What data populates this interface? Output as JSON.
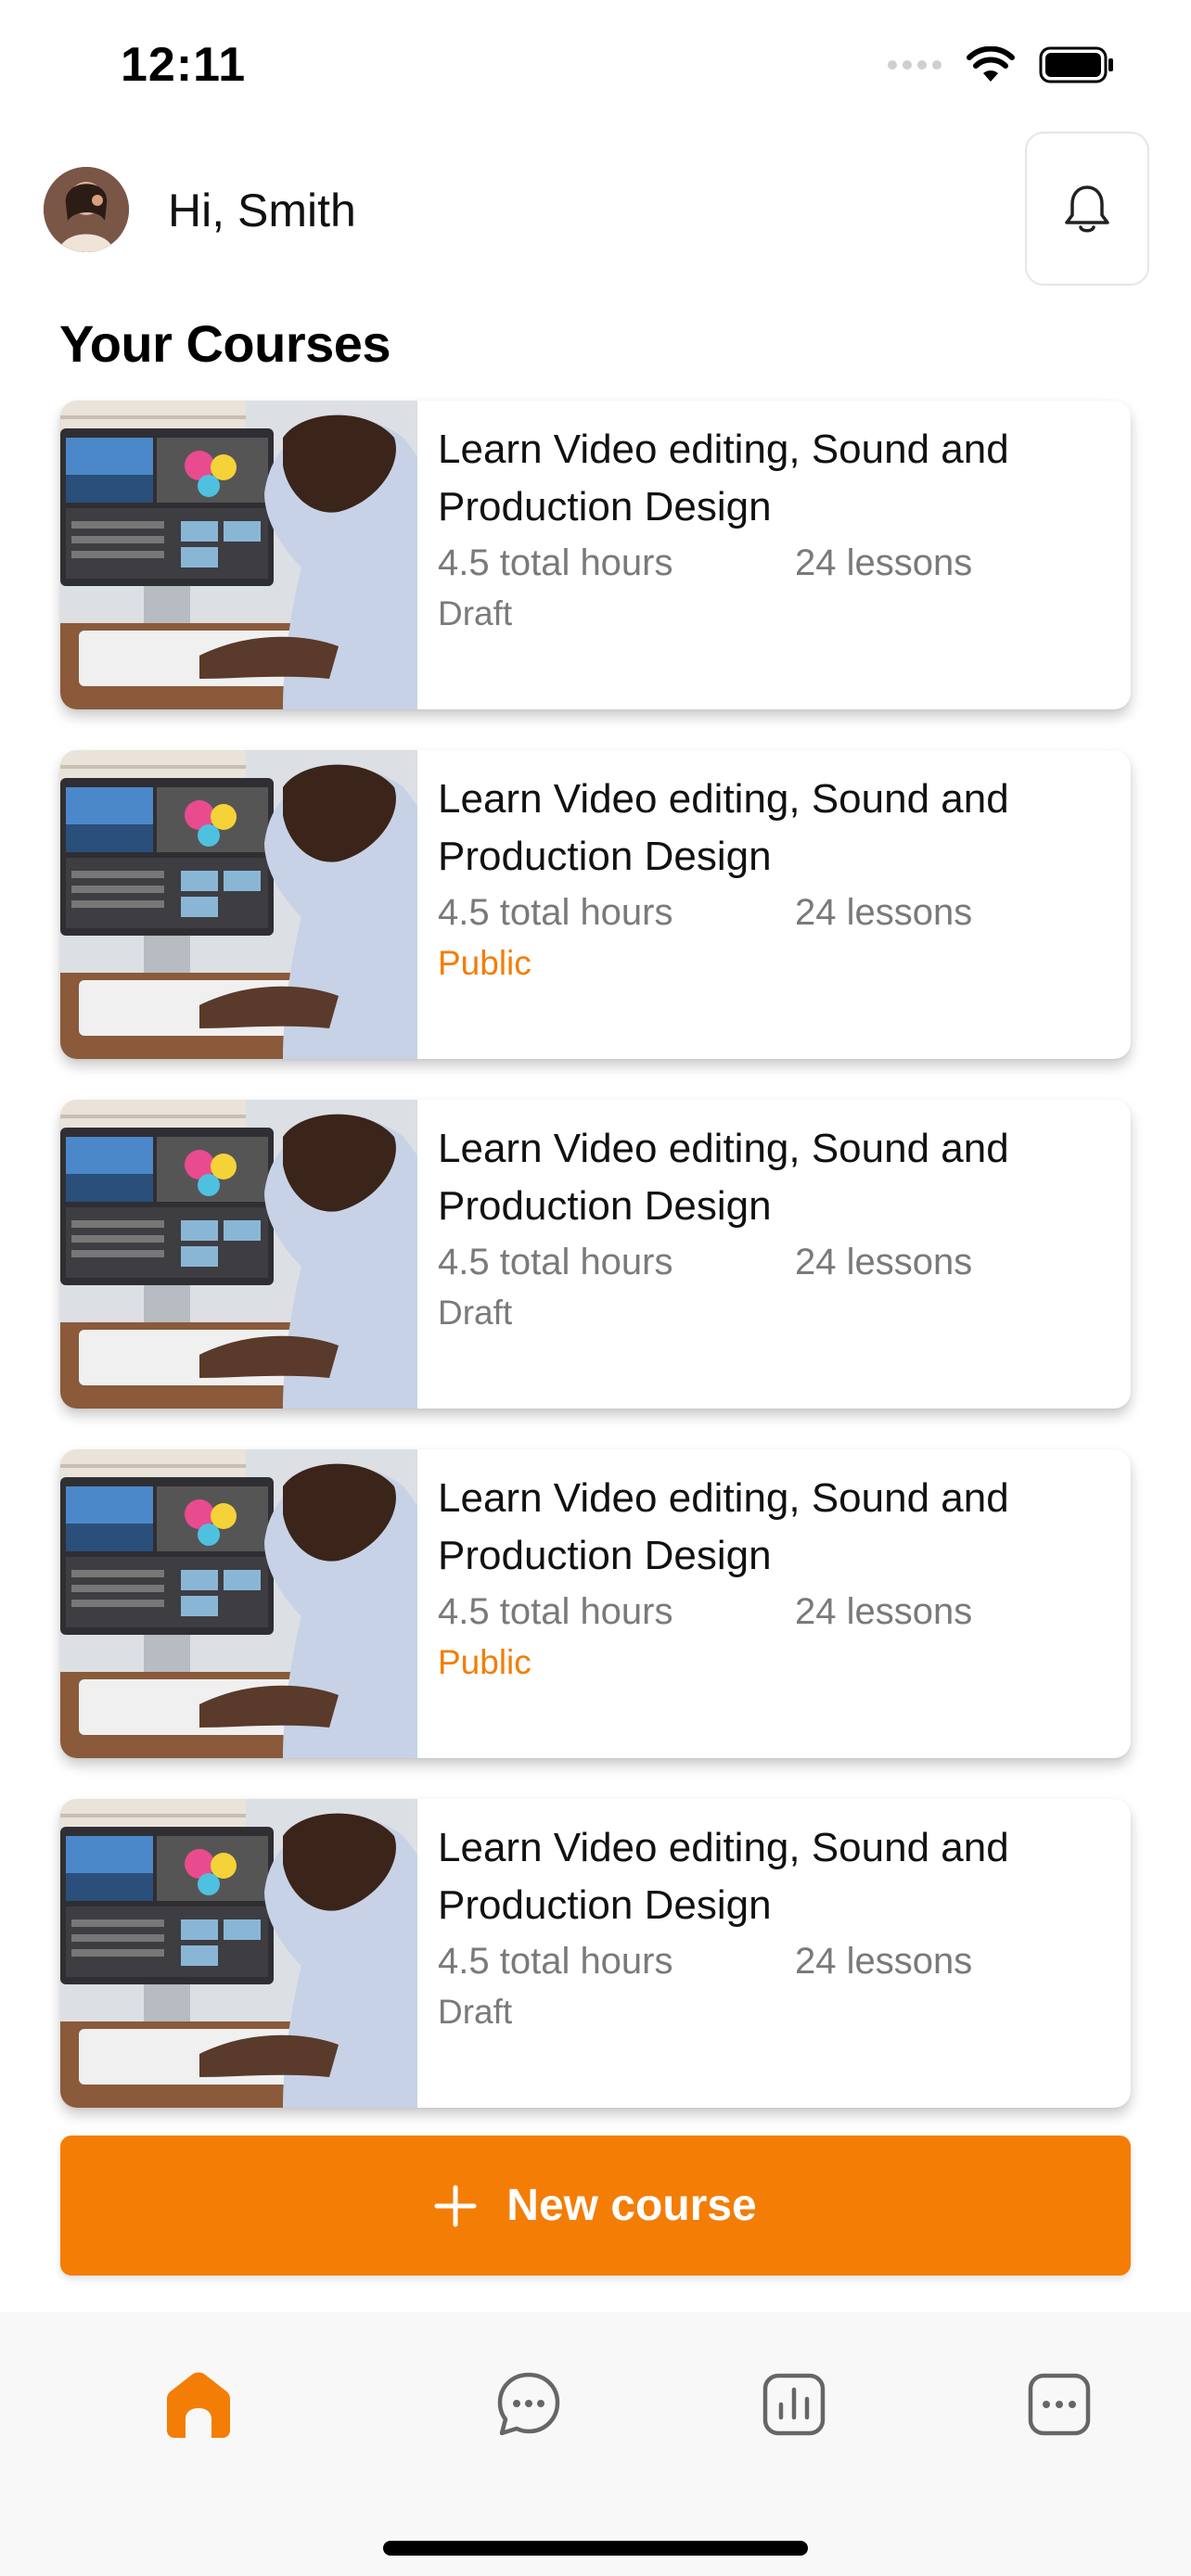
{
  "status_bar": {
    "time": "12:11"
  },
  "header": {
    "greeting": "Hi, Smith"
  },
  "section_title": "Your Courses",
  "courses": [
    {
      "title": "Learn Video editing, Sound and Production Design",
      "hours": "4.5 total hours",
      "lessons": "24 lessons",
      "status": "Draft"
    },
    {
      "title": "Learn Video editing, Sound and Production Design",
      "hours": "4.5 total hours",
      "lessons": "24 lessons",
      "status": "Public"
    },
    {
      "title": "Learn Video editing, Sound and Production Design",
      "hours": "4.5 total hours",
      "lessons": "24 lessons",
      "status": "Draft"
    },
    {
      "title": "Learn Video editing, Sound and Production Design",
      "hours": "4.5 total hours",
      "lessons": "24 lessons",
      "status": "Public"
    },
    {
      "title": "Learn Video editing, Sound and Production Design",
      "hours": "4.5 total hours",
      "lessons": "24 lessons",
      "status": "Draft"
    }
  ],
  "new_course_button": {
    "label": "New course"
  },
  "bottom_nav": {
    "items": [
      {
        "icon": "home-icon",
        "active": true
      },
      {
        "icon": "chat-icon",
        "active": false
      },
      {
        "icon": "stats-icon",
        "active": false
      },
      {
        "icon": "more-icon",
        "active": false
      }
    ]
  },
  "colors": {
    "accent": "#f47d06",
    "muted_text": "#7a7a7a",
    "nav_inactive": "#666666"
  }
}
